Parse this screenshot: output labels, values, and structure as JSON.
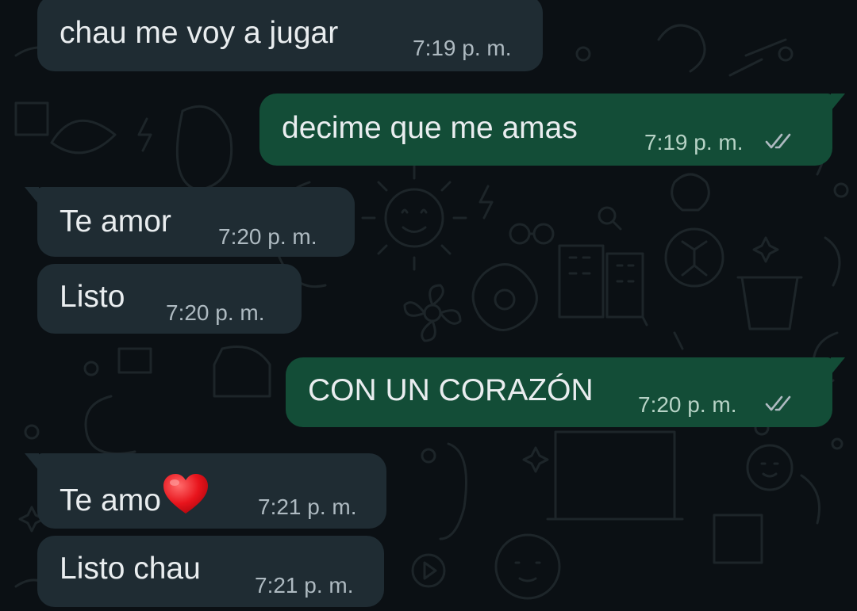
{
  "messages": [
    {
      "direction": "incoming",
      "text": "chau me voy a jugar",
      "time": "7:19 p. m."
    },
    {
      "direction": "outgoing",
      "text": "decime que me amas",
      "time": "7:19 p. m.",
      "status": "read",
      "status_icon": "double-check-icon"
    },
    {
      "direction": "incoming",
      "text": "Te amor",
      "time": "7:20 p. m."
    },
    {
      "direction": "incoming",
      "text": "Listo",
      "time": "7:20 p. m."
    },
    {
      "direction": "outgoing",
      "text": "CON UN CORAZÓN",
      "time": "7:20 p. m.",
      "status": "read",
      "status_icon": "double-check-icon"
    },
    {
      "direction": "incoming",
      "text": "Te amo",
      "emoji": "heart-emoji",
      "time": "7:21 p. m."
    },
    {
      "direction": "incoming",
      "text": "Listo chau",
      "time": "7:21 p. m."
    }
  ],
  "colors": {
    "background": "#0b1014",
    "incoming_bubble": "#1f2c33",
    "outgoing_bubble": "#134d37",
    "message_text": "#e9edef",
    "timestamp": "#aebac1",
    "doodle_stroke": "#1d2529"
  }
}
